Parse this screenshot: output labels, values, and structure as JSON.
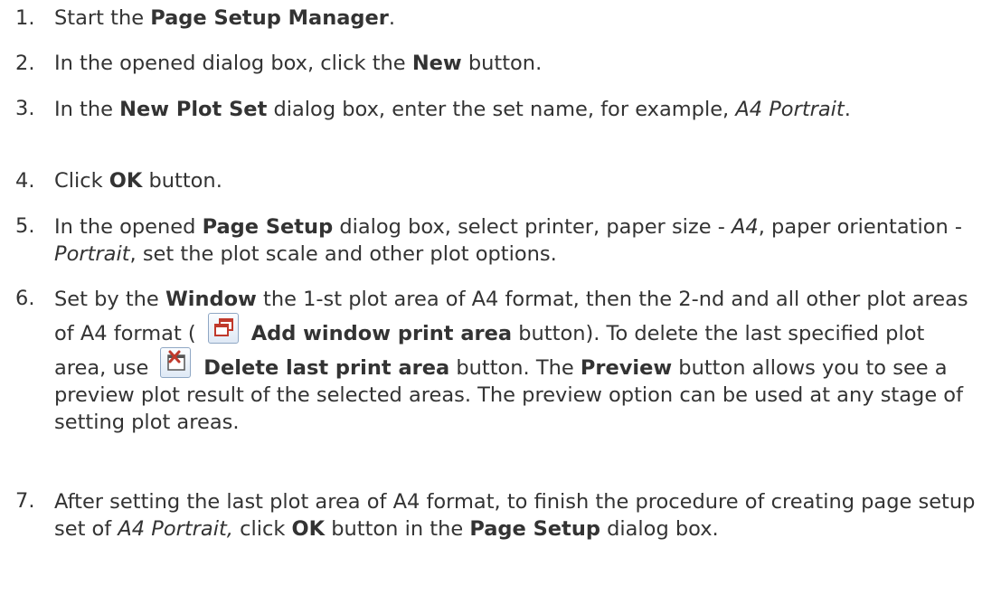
{
  "steps": [
    {
      "num": "1.",
      "segments": [
        {
          "t": "Start the "
        },
        {
          "t": "Page Setup Manager",
          "b": true
        },
        {
          "t": "."
        }
      ]
    },
    {
      "num": "2.",
      "segments": [
        {
          "t": "In the opened dialog box, click the "
        },
        {
          "t": "New",
          "b": true
        },
        {
          "t": " button."
        }
      ]
    },
    {
      "num": "3.",
      "segments": [
        {
          "t": "In the "
        },
        {
          "t": "New Plot Set",
          "b": true
        },
        {
          "t": " dialog box, enter the set name, for example, "
        },
        {
          "t": "A4 Portrait",
          "i": true
        },
        {
          "t": "."
        }
      ]
    },
    {
      "num": "4.",
      "segments": [
        {
          "t": "Click "
        },
        {
          "t": "OK",
          "b": true
        },
        {
          "t": " button."
        }
      ]
    },
    {
      "num": "5.",
      "segments": [
        {
          "t": "In the opened "
        },
        {
          "t": "Page Setup",
          "b": true
        },
        {
          "t": " dialog box, select printer, paper size - "
        },
        {
          "t": "A4",
          "i": true
        },
        {
          "t": ", paper orientation - "
        },
        {
          "t": "Portrait",
          "i": true
        },
        {
          "t": ", set the plot scale and other plot options."
        }
      ]
    },
    {
      "num": "6.",
      "segments": [
        {
          "t": "Set by the "
        },
        {
          "t": "Window",
          "b": true
        },
        {
          "t": " the 1-st plot area of A4 format, then the 2-nd and all other plot areas of A4 format ( "
        },
        {
          "icon": "add-window-print-area-icon"
        },
        {
          "t": " Add window print area",
          "b": true
        },
        {
          "t": " button). To delete the last specified plot area, use "
        },
        {
          "icon": "delete-last-print-area-icon"
        },
        {
          "t": " Delete last print area",
          "b": true
        },
        {
          "t": " button. The "
        },
        {
          "t": "Preview",
          "b": true
        },
        {
          "t": " button allows you to see a preview plot result of the selected areas. The preview option can be used at any stage of setting plot areas."
        }
      ]
    },
    {
      "num": "7.",
      "segments": [
        {
          "t": "After setting the last plot area of A4 format, to finish the procedure of creating page setup set of "
        },
        {
          "t": "A4 Portrait,",
          "i": true
        },
        {
          "t": " click "
        },
        {
          "t": "OK",
          "b": true
        },
        {
          "t": " button in the "
        },
        {
          "t": "Page Setup",
          "b": true
        },
        {
          "t": " dialog box."
        }
      ]
    }
  ],
  "colors": {
    "text": "#333333",
    "icon_border": "#8fa7c4",
    "icon_red": "#c0392b"
  }
}
